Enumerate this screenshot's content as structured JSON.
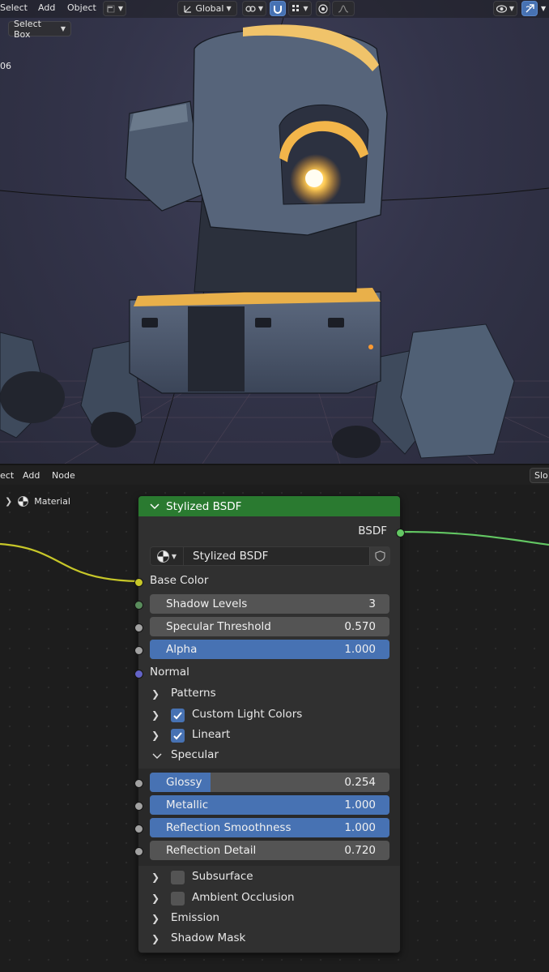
{
  "viewport": {
    "menu": [
      "Select",
      "Add",
      "Object"
    ],
    "orientation": "Global",
    "select_mode": "Select Box",
    "frame_label": "06"
  },
  "node_editor": {
    "menu": [
      "ect",
      "Add",
      "Node"
    ],
    "right_button": "Slo",
    "breadcrumb": "Material",
    "node": {
      "title": "Stylized BSDF",
      "output": "BSDF",
      "group_name": "Stylized BSDF",
      "inputs": {
        "base_color": "Base Color",
        "normal": "Normal"
      },
      "fields": [
        {
          "label": "Shadow Levels",
          "value": "3",
          "fill": 0
        },
        {
          "label": "Specular Threshold",
          "value": "0.570",
          "fill": 0
        },
        {
          "label": "Alpha",
          "value": "1.000",
          "fill": 1.0
        }
      ],
      "panels_top": [
        {
          "label": "Patterns",
          "checkbox": null
        },
        {
          "label": "Custom Light Colors",
          "checkbox": true
        },
        {
          "label": "Lineart",
          "checkbox": true
        }
      ],
      "specular_panel": {
        "label": "Specular",
        "fields": [
          {
            "label": "Glossy",
            "value": "0.254",
            "fill": 0.254
          },
          {
            "label": "Metallic",
            "value": "1.000",
            "fill": 1.0
          },
          {
            "label": "Reflection Smoothness",
            "value": "1.000",
            "fill": 1.0
          },
          {
            "label": "Reflection Detail",
            "value": "0.720",
            "fill": 0
          }
        ]
      },
      "panels_bottom": [
        {
          "label": "Subsurface",
          "checkbox": false
        },
        {
          "label": "Ambient Occlusion",
          "checkbox": false
        },
        {
          "label": "Emission",
          "checkbox": null
        },
        {
          "label": "Shadow Mask",
          "checkbox": null
        }
      ]
    }
  },
  "colors": {
    "node_header": "#2a7a30",
    "accent_blue": "#4772b3",
    "socket_color": "#c7c729",
    "socket_shader": "#63c763",
    "socket_int": "#598c5c",
    "socket_float": "#a1a1a1",
    "socket_vector": "#6363c7"
  },
  "icons": [
    "material-sphere-icon",
    "shield-icon",
    "checkmark-icon",
    "chevron-right-icon",
    "chevron-down-icon",
    "cursor-icon",
    "eye-icon"
  ]
}
